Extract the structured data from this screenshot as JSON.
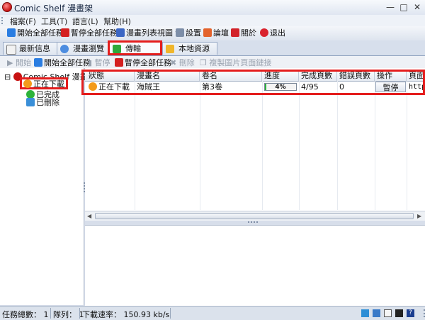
{
  "window": {
    "title": "Comic Shelf 漫畫架",
    "buttons": [
      "—",
      "□",
      "✕"
    ]
  },
  "menu": [
    "檔案(F)",
    "工具(T)",
    "語言(L)",
    "幫助(H)"
  ],
  "toolbar": {
    "start_all": "開始全部任務",
    "pause_all": "暫停全部任務",
    "view": "漫畫列表視圖",
    "settings": "設置",
    "forum": "論壇",
    "about": "關於",
    "exit": "退出"
  },
  "tabs": [
    "最新信息",
    "漫畫瀏覽器",
    "傳輸",
    "本地資源"
  ],
  "subtoolbar": {
    "start": "開始",
    "start_all": "開始全部任務",
    "pause": "暫停",
    "pause_all": "暫停全部任務",
    "delete": "刪除",
    "copy_url": "複製圖片頁面鏈接"
  },
  "tree": {
    "root": "Comic Shelf 漫畫架",
    "items": [
      "正在下載",
      "已完成",
      "已刪除"
    ]
  },
  "grid": {
    "columns": [
      "狀態",
      "漫畫名",
      "卷名",
      "進度",
      "完成頁數",
      "錯誤頁數",
      "操作",
      "頁面"
    ],
    "rows": [
      {
        "status": "正在下載",
        "comic": "海賊王",
        "volume": "第3卷",
        "progress_pct": 4,
        "progress_label": "4%",
        "done": "4/95",
        "errors": "0",
        "action": "暫停",
        "page": "http"
      }
    ]
  },
  "status": {
    "total_label": "任務總數：",
    "total": "1",
    "queue_label": "隊列：",
    "queue": "1",
    "speed_label": "下載速率：",
    "speed": "150.93 kb/s"
  },
  "colors": {
    "highlight": "#e41d1d",
    "progress_fill": "#2db33b"
  }
}
